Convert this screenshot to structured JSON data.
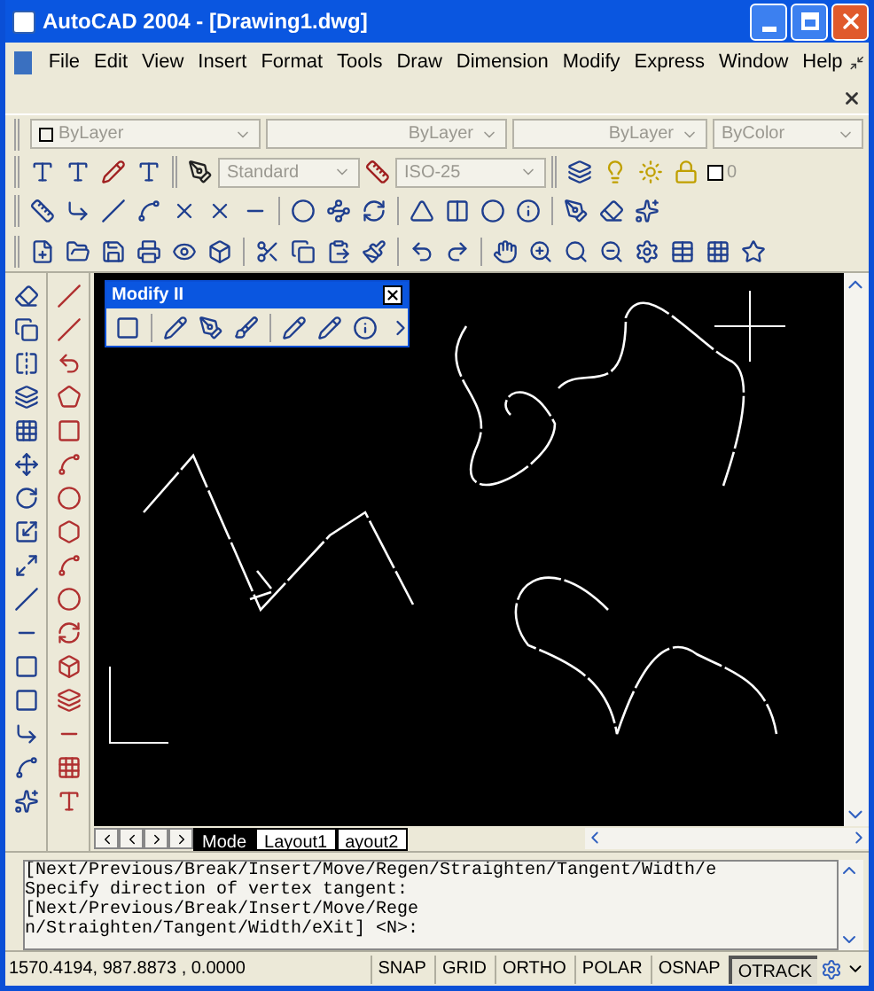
{
  "window": {
    "title": "AutoCAD 2004 - [Drawing1.dwg]"
  },
  "menu": [
    "File",
    "Edit",
    "View",
    "Insert",
    "Format",
    "Tools",
    "Draw",
    "Dimension",
    "Modify",
    "Express",
    "Window",
    "Help"
  ],
  "properties_toolbar": {
    "color_control": "ByLayer",
    "linetype": "ByLayer",
    "lineweight": "ByLayer",
    "plot_style": "ByColor"
  },
  "styles_toolbar": {
    "text_style": "Standard",
    "dim_style": "ISO-25"
  },
  "layers_toolbar": {
    "layer": "0"
  },
  "floating_toolbar": {
    "title": "Modify II"
  },
  "layout_tabs": [
    {
      "label": "Mode",
      "selected": true
    },
    {
      "label": "Layout1",
      "selected": false
    },
    {
      "label": "ayout2",
      "selected": false
    }
  ],
  "command_history": [
    "[Next/Previous/Break/Insert/Move/Regen/Straighten/Tangent/Width/e",
    "Specify direction of vertex tangent:"
  ],
  "command_prompt": "[Next/Previous/Break/Insert/Move/Regen/Straighten/Tangent/Width/eXit] <N>:",
  "status_bar": {
    "coordinates": "1570.4194, 987.8873 , 0.0000",
    "toggles": [
      {
        "label": "SNAP",
        "on": false
      },
      {
        "label": "GRID",
        "on": false
      },
      {
        "label": "ORTHO",
        "on": false
      },
      {
        "label": "POLAR",
        "on": false
      },
      {
        "label": "OSNAP",
        "on": false
      },
      {
        "label": "OTRACK",
        "on": true
      }
    ]
  }
}
